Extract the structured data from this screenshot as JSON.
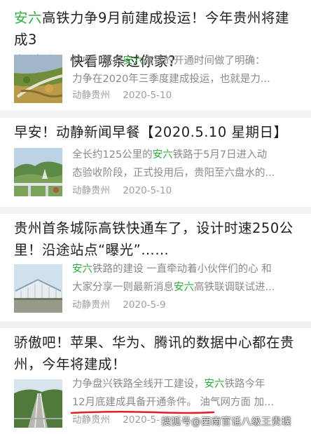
{
  "feed": {
    "articles": [
      {
        "title_pre": "",
        "title_kw": "安六",
        "title_post": "高铁力争9月前建成投运！今年贵州将建成3条铁路，快看哪条过你家？",
        "title_lines": [
          "高铁力争9月前建成投运！今年贵州将建成3",
          "条铁路，快看哪条过你家？"
        ],
        "snippet_line1_pre": "其中，还对",
        "snippet_line1_kw": "安六",
        "snippet_line1_post": "高铁的开通时间做了明确：",
        "snippet_line2": "力争在2020年三季度建成投运，也就是力...",
        "source": "动静贵州",
        "date": "2020-5-10"
      },
      {
        "title_lines": [
          "早安！动静新闻早餐【2020.5.10 星期日】"
        ],
        "snippet_line1_pre": "全长约125公里的",
        "snippet_line1_kw": "安六",
        "snippet_line1_post": "铁路于5月7日进入动",
        "snippet_line2": "态验收阶段，正式投用后，贵阳至六盘水的...",
        "source": "动静贵州",
        "date": "2020-5-10"
      },
      {
        "title_lines": [
          "贵州首条城际高铁快通车了，设计时速250公",
          "里！沿途站点“曝光”……"
        ],
        "snippet_line1_kw": "安六",
        "snippet_line1_post": "铁路的建设 一直牵动着小伙伴们的心 和",
        "snippet_line2_pre": "大家分享一则最新消息",
        "snippet_line2_kw": "安六",
        "snippet_line2_post": "高铁联调联试进...",
        "source": "动静贵州",
        "date": "2020-5-9"
      },
      {
        "title_lines": [
          "骄傲吧！苹果、华为、腾讯的数据中心都在贵",
          "州，今年将建成！"
        ],
        "snippet_line1_pre": "力争盘兴铁路全线开工建设，",
        "snippet_line1_kw": "安六",
        "snippet_line1_post": "铁路今年",
        "snippet_line2": "12月底建成具备开通条件。 油气网方面 加...",
        "source": "动静贵州",
        "date": "2020-5-"
      }
    ]
  },
  "watermark": "搜狐号@西南官话八级王贵璞",
  "colors": {
    "keyword": "#2fae3f",
    "divider": "#f2f2f2",
    "meta": "#9e9e9e",
    "annotation": "#e02020"
  }
}
